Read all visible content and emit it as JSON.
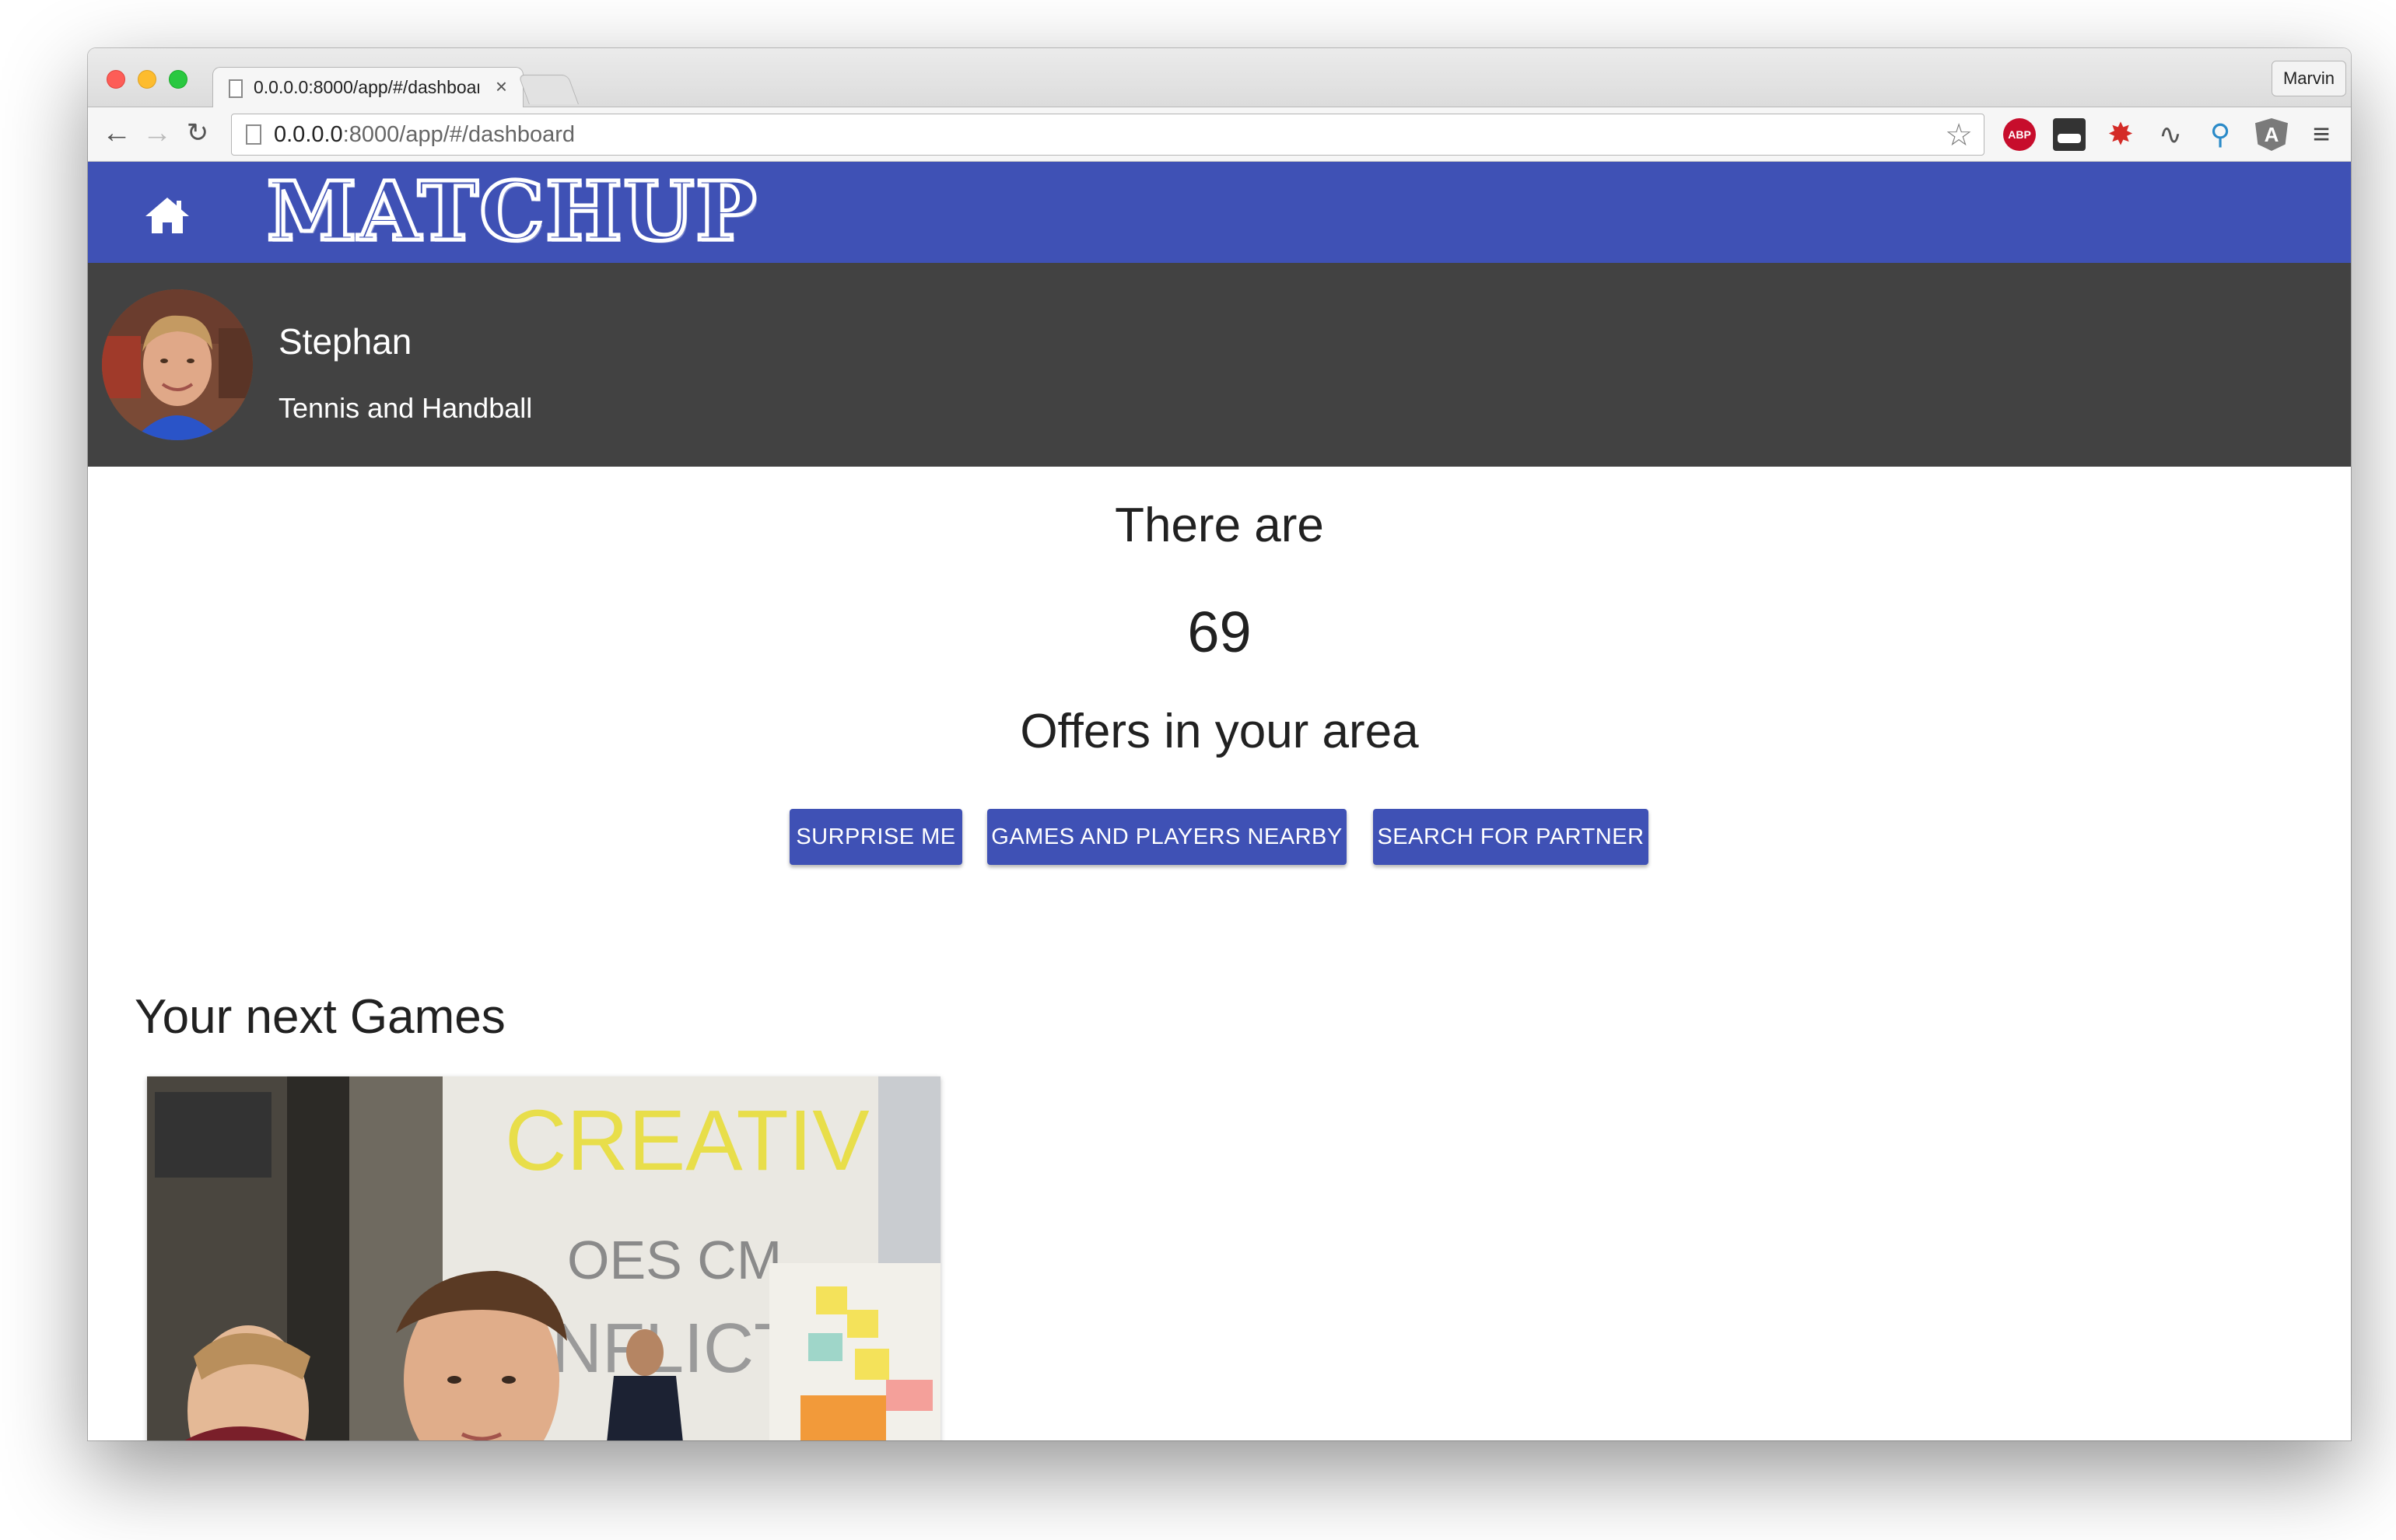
{
  "browser": {
    "tab_title": "0.0.0.0:8000/app/#/dashboard",
    "tab_close": "×",
    "profile": "Marvin",
    "url_host": "0.0.0.0",
    "url_rest": ":8000/app/#/dashboard",
    "nav": {
      "back": "←",
      "forward": "→",
      "reload": "↻"
    },
    "star": "☆",
    "extensions": [
      {
        "name": "adblock-plus-icon",
        "label": "ABP"
      },
      {
        "name": "incognito-spy-icon",
        "label": ""
      },
      {
        "name": "bug-icon",
        "label": "✸"
      },
      {
        "name": "waveform-icon",
        "label": "∿"
      },
      {
        "name": "network-icon",
        "label": "⚲"
      },
      {
        "name": "angular-icon",
        "label": "A"
      },
      {
        "name": "menu-icon",
        "label": "≡"
      }
    ]
  },
  "app": {
    "brand": "MATCHUP",
    "colors": {
      "primary": "#3f51b5",
      "profile_bg": "#424242"
    }
  },
  "profile": {
    "name": "Stephan",
    "sports": "Tennis and Handball"
  },
  "offers": {
    "intro": "There are",
    "count": "69",
    "label": "Offers in your area"
  },
  "actions": {
    "surprise": "SURPRISE ME",
    "nearby": "GAMES AND PLAYERS NEARBY",
    "search": "SEARCH FOR PARTNER"
  },
  "games": {
    "heading": "Your next Games"
  }
}
